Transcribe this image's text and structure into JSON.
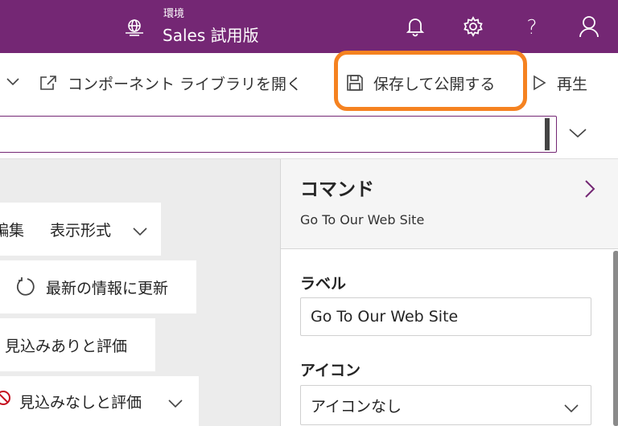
{
  "header": {
    "env_label": "環境",
    "env_name": "Sales 試用版",
    "help_label": "?"
  },
  "toolbar": {
    "open_library_label": "コンポーネント ライブラリを開く",
    "save_publish_label": "保存して公開する",
    "play_label": "再生"
  },
  "formula": {
    "value": ""
  },
  "canvas": {
    "buttons": [
      {
        "label_partial": "編集",
        "label": "表示形式"
      },
      {
        "label": "最新の情報に更新"
      },
      {
        "label": "見込みありと評価"
      },
      {
        "label": "見込みなしと評価"
      }
    ]
  },
  "panel": {
    "title": "コマンド",
    "subtitle": "Go To Our Web Site",
    "label_heading": "ラベル",
    "label_value": "Go To Our Web Site",
    "icon_heading": "アイコン",
    "icon_value": "アイコンなし"
  },
  "colors": {
    "brand": "#742774",
    "highlight": "#f58220",
    "canvas_bg": "#ececec"
  },
  "icons": [
    "environment-icon",
    "bell-icon",
    "gear-icon",
    "help-icon",
    "user-icon",
    "chevron-down-icon",
    "open-external-icon",
    "save-icon",
    "play-icon",
    "refresh-icon",
    "ban-icon",
    "chevron-right-icon"
  ]
}
